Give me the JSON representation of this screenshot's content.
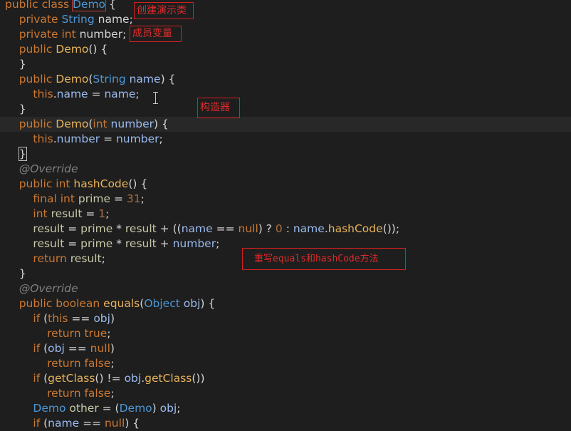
{
  "code": {
    "lines": [
      [
        [
          "kw",
          "public class "
        ],
        [
          "cls",
          "Demo",
          "sel"
        ],
        [
          "p",
          " {"
        ]
      ],
      [
        [
          "kw",
          "    private "
        ],
        [
          "cls",
          "String"
        ],
        [
          "p",
          " name;"
        ]
      ],
      [
        [
          "kw",
          "    private int"
        ],
        [
          "p",
          " number;"
        ]
      ],
      [
        [
          "kw",
          "    public "
        ],
        [
          "m",
          "Demo"
        ],
        [
          "p",
          "() {"
        ]
      ],
      [
        [
          "p",
          "    }"
        ]
      ],
      [
        [
          "kw",
          "    public "
        ],
        [
          "m",
          "Demo"
        ],
        [
          "p",
          "("
        ],
        [
          "cls",
          "String"
        ],
        [
          "p",
          " "
        ],
        [
          "fld",
          "name"
        ],
        [
          "p",
          ") {"
        ]
      ],
      [
        [
          "kw",
          "        this"
        ],
        [
          "p",
          "."
        ],
        [
          "fld",
          "name"
        ],
        [
          "p",
          " = "
        ],
        [
          "fld",
          "name"
        ],
        [
          "p",
          ";"
        ]
      ],
      [
        [
          "p",
          "    }"
        ]
      ],
      [
        [
          "kw",
          "    public "
        ],
        [
          "m",
          "Demo"
        ],
        [
          "p",
          "("
        ],
        [
          "kw",
          "int "
        ],
        [
          "fld",
          "number"
        ],
        [
          "p",
          ") {"
        ]
      ],
      [
        [
          "kw",
          "        this"
        ],
        [
          "p",
          "."
        ],
        [
          "fld",
          "number"
        ],
        [
          "p",
          " = "
        ],
        [
          "fld",
          "number"
        ],
        [
          "p",
          ";"
        ]
      ],
      [
        [
          "p",
          "    "
        ],
        [
          "p",
          "}",
          "brk"
        ]
      ],
      [
        [
          "ann",
          "    @Override"
        ]
      ],
      [
        [
          "kw",
          "    public int "
        ],
        [
          "m",
          "hashCode"
        ],
        [
          "p",
          "() {"
        ]
      ],
      [
        [
          "kw",
          "        final int "
        ],
        [
          "var",
          "prime"
        ],
        [
          "p",
          " = "
        ],
        [
          "num",
          "31"
        ],
        [
          "p",
          ";"
        ]
      ],
      [
        [
          "kw",
          "        int "
        ],
        [
          "var",
          "result"
        ],
        [
          "p",
          " = "
        ],
        [
          "num",
          "1"
        ],
        [
          "p",
          ";"
        ]
      ],
      [
        [
          "var",
          "        result"
        ],
        [
          "p",
          " = "
        ],
        [
          "var",
          "prime"
        ],
        [
          "p",
          " * "
        ],
        [
          "var",
          "result"
        ],
        [
          "p",
          " + (("
        ],
        [
          "fld",
          "name"
        ],
        [
          "p",
          " == "
        ],
        [
          "kw",
          "null"
        ],
        [
          "p",
          ") ? "
        ],
        [
          "num",
          "0"
        ],
        [
          "p",
          " : "
        ],
        [
          "fld",
          "name"
        ],
        [
          "p",
          "."
        ],
        [
          "m",
          "hashCode"
        ],
        [
          "p",
          "());"
        ]
      ],
      [
        [
          "var",
          "        result"
        ],
        [
          "p",
          " = "
        ],
        [
          "var",
          "prime"
        ],
        [
          "p",
          " * "
        ],
        [
          "var",
          "result"
        ],
        [
          "p",
          " + "
        ],
        [
          "fld",
          "number"
        ],
        [
          "p",
          ";"
        ]
      ],
      [
        [
          "kw",
          "        return "
        ],
        [
          "var",
          "result"
        ],
        [
          "p",
          ";"
        ]
      ],
      [
        [
          "p",
          "    }"
        ]
      ],
      [
        [
          "ann",
          "    @Override"
        ]
      ],
      [
        [
          "kw",
          "    public boolean "
        ],
        [
          "m",
          "equals"
        ],
        [
          "p",
          "("
        ],
        [
          "cls",
          "Object"
        ],
        [
          "p",
          " "
        ],
        [
          "fld",
          "obj"
        ],
        [
          "p",
          ") {"
        ]
      ],
      [
        [
          "kw",
          "        if"
        ],
        [
          "p",
          " ("
        ],
        [
          "kw",
          "this"
        ],
        [
          "p",
          " == "
        ],
        [
          "fld",
          "obj"
        ],
        [
          "p",
          ")"
        ]
      ],
      [
        [
          "kw",
          "            return true"
        ],
        [
          "p",
          ";"
        ]
      ],
      [
        [
          "kw",
          "        if"
        ],
        [
          "p",
          " ("
        ],
        [
          "fld",
          "obj"
        ],
        [
          "p",
          " == "
        ],
        [
          "kw",
          "null"
        ],
        [
          "p",
          ")"
        ]
      ],
      [
        [
          "kw",
          "            return false"
        ],
        [
          "p",
          ";"
        ]
      ],
      [
        [
          "kw",
          "        if"
        ],
        [
          "p",
          " ("
        ],
        [
          "m",
          "getClass"
        ],
        [
          "p",
          "() != "
        ],
        [
          "fld",
          "obj"
        ],
        [
          "p",
          "."
        ],
        [
          "m",
          "getClass"
        ],
        [
          "p",
          "())"
        ]
      ],
      [
        [
          "kw",
          "            return false"
        ],
        [
          "p",
          ";"
        ]
      ],
      [
        [
          "cls",
          "        Demo"
        ],
        [
          "p",
          " "
        ],
        [
          "var",
          "other"
        ],
        [
          "p",
          " = ("
        ],
        [
          "cls",
          "Demo"
        ],
        [
          "p",
          ") "
        ],
        [
          "fld",
          "obj"
        ],
        [
          "p",
          ";"
        ]
      ],
      [
        [
          "kw",
          "        if"
        ],
        [
          "p",
          " ("
        ],
        [
          "fld",
          "name"
        ],
        [
          "p",
          " == "
        ],
        [
          "kw",
          "null"
        ],
        [
          "p",
          ") {"
        ]
      ]
    ]
  },
  "annotations": {
    "create_class": "创建演示类",
    "member_vars": "成员变量",
    "constructor": "构造器",
    "override_methods": "重写equals和hashCode方法"
  },
  "colors": {
    "background": "#1e1e1e",
    "keyword": "#cc7832",
    "class": "#4d96d4",
    "method": "#e9b45c",
    "field": "#9bbbf0",
    "variable": "#c8c8a8",
    "number": "#ad6f40",
    "annotation": "#7f7f7f",
    "note_border": "#d62020"
  }
}
